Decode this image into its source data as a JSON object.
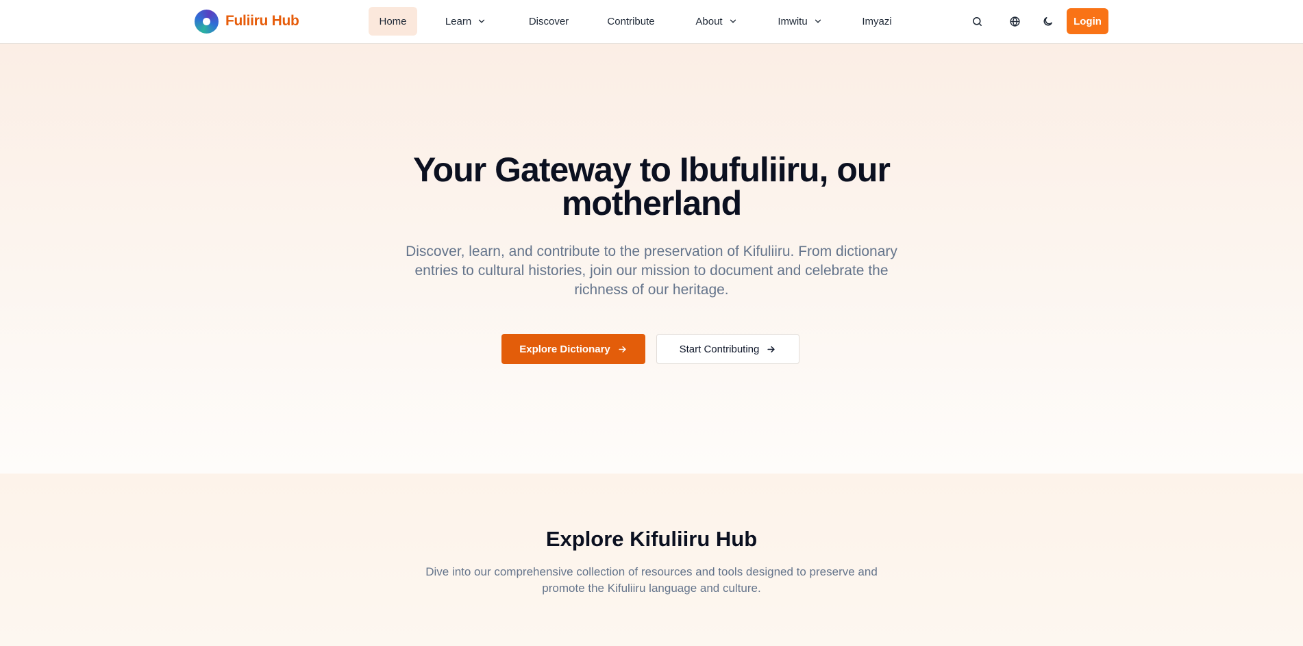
{
  "brand": {
    "name": "Fuliiru Hub",
    "accent": "#e65c0a"
  },
  "nav": {
    "home": "Home",
    "learn": "Learn",
    "discover": "Discover",
    "contribute": "Contribute",
    "about": "About",
    "imwitu": "Imwitu",
    "imyazi": "Imyazi"
  },
  "header_actions": {
    "search_icon": "search-icon",
    "language_icon": "globe-icon",
    "theme_icon": "moon-icon",
    "login": "Login",
    "login_color": "#f97316"
  },
  "hero": {
    "title": "Your Gateway to Ibufuliiru, our motherland",
    "subtitle": "Discover, learn, and contribute to the preservation of Kifuliiru. From dictionary entries to cultural histories, join our mission to document and celebrate the richness of our heritage.",
    "primary_cta": "Explore Dictionary",
    "secondary_cta": "Start Contributing",
    "primary_color": "#e35d0a"
  },
  "explore": {
    "title": "Explore Kifuliiru Hub",
    "subtitle": "Dive into our comprehensive collection of resources and tools designed to preserve and promote the Kifuliiru language and culture."
  }
}
